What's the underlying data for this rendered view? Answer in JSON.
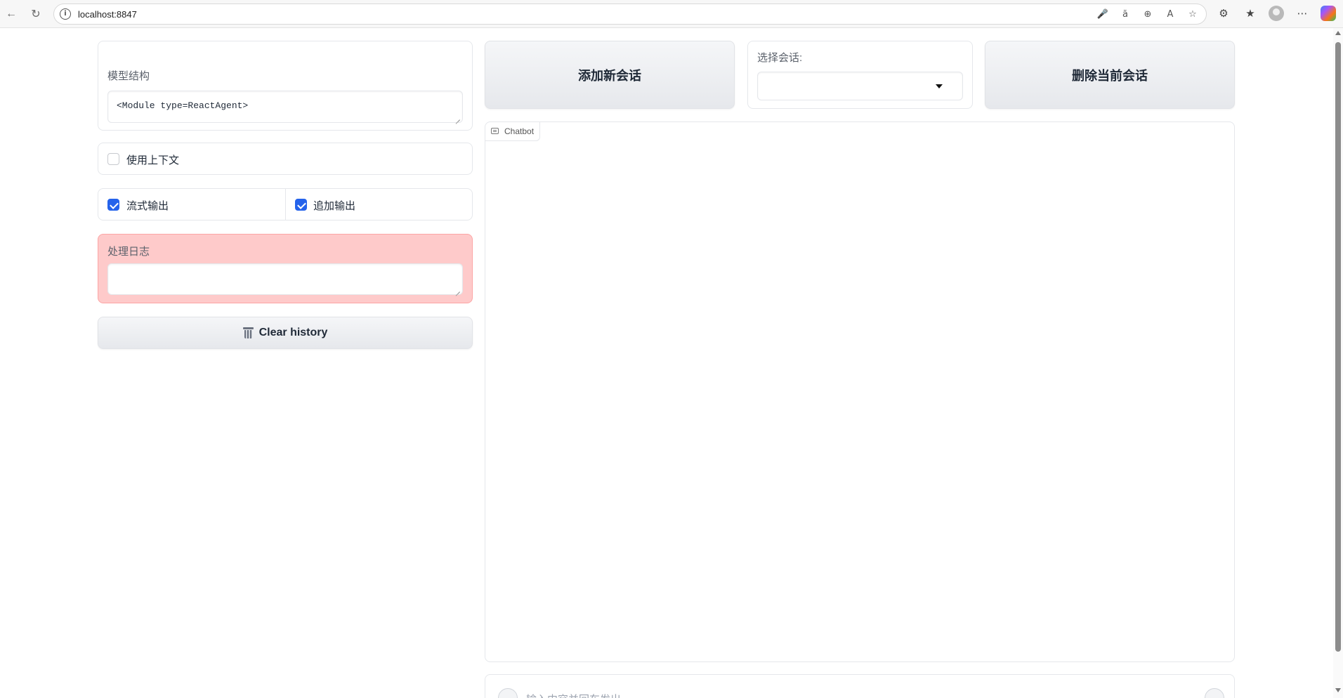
{
  "browser": {
    "url": "localhost:8847",
    "icons": [
      "back-icon",
      "refresh-icon",
      "info-icon",
      "mic-icon",
      "translate-icon",
      "zoom-icon",
      "read-aloud-icon",
      "favorite-icon",
      "extensions-icon",
      "favorites-icon",
      "profile-avatar",
      "more-icon",
      "copilot-icon"
    ]
  },
  "left": {
    "model_label": "模型结构",
    "model_value": "<Module type=ReactAgent>",
    "use_context_label": "使用上下文",
    "use_context_checked": false,
    "stream_label": "流式输出",
    "stream_checked": true,
    "append_label": "追加输出",
    "append_checked": true,
    "log_label": "处理日志",
    "log_value": "",
    "clear_label": "Clear history"
  },
  "top": {
    "add_session": "添加新会话",
    "select_label": "选择会话:",
    "select_value": "",
    "delete_session": "删除当前会话"
  },
  "chat": {
    "tag": "Chatbot",
    "input_placeholder": "输入内容并回车发出"
  },
  "colors": {
    "accent": "#2563eb",
    "log_bg": "#fecaca",
    "button_bg": "#e8eaee"
  }
}
